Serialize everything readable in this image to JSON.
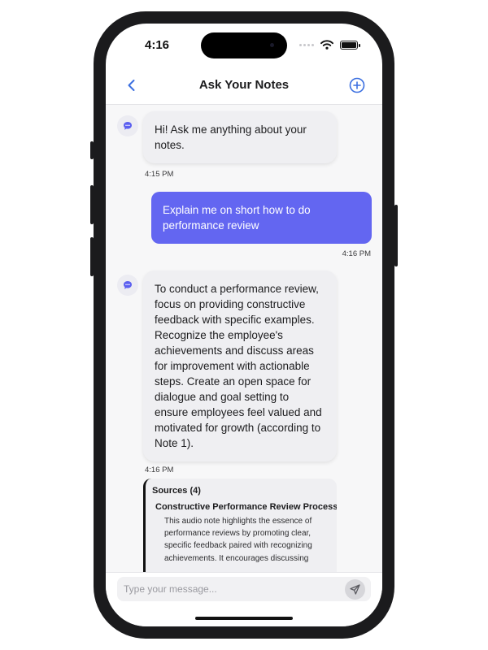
{
  "status_bar": {
    "time": "4:16"
  },
  "nav": {
    "title": "Ask Your Notes"
  },
  "messages": [
    {
      "sender": "assistant",
      "text": "Hi! Ask me anything about your notes.",
      "time": "4:15 PM"
    },
    {
      "sender": "user",
      "text": "Explain me on short how to do performance review",
      "time": "4:16 PM"
    },
    {
      "sender": "assistant",
      "text": "To conduct a performance review, focus on providing constructive feedback with specific examples. Recognize the employee's achievements and discuss areas for improvement with actionable steps. Create an open space for dialogue and goal setting to ensure employees feel valued and motivated for growth (according to Note 1).",
      "time": "4:16 PM"
    }
  ],
  "sources": {
    "title": "Sources (4)",
    "items": [
      {
        "title": "Constructive Performance Review Process",
        "description": "This audio note highlights the essence of performance reviews by promoting clear, specific feedback paired with recognizing achievements. It encourages discussing"
      }
    ]
  },
  "input": {
    "placeholder": "Type your message..."
  },
  "colors": {
    "accent": "#6366f1",
    "bubble_bot": "#efeff2",
    "chat_bg": "#f7f7f8",
    "nav_icon": "#3b6fe0"
  },
  "icons": {
    "back": "chevron-left-icon",
    "add": "plus-circle-icon",
    "bot": "chat-bubble-icon",
    "source": "document-icon",
    "send": "send-icon"
  }
}
